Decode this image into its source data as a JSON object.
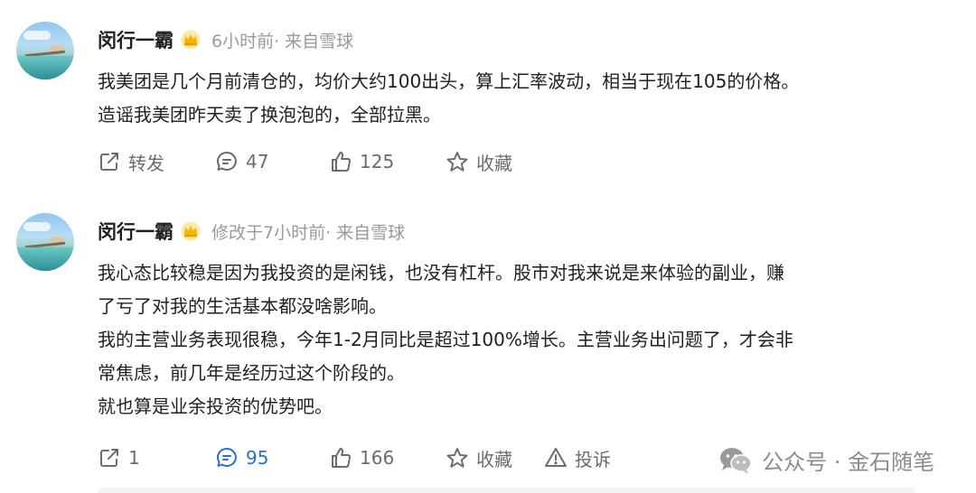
{
  "posts": [
    {
      "author": "闵行一霸",
      "meta": "6小时前· 来自雪球",
      "lines": [
        "我美团是几个月前清仓的，均价大约100出头，算上汇率波动，相当于现在105的价格。",
        "造谣我美团昨天卖了换泡泡的，全部拉黑。"
      ],
      "actions": {
        "repost": "转发",
        "comment": "47",
        "like": "125",
        "favorite": "收藏"
      }
    },
    {
      "author": "闵行一霸",
      "meta": "修改于7小时前· 来自雪球",
      "lines": [
        "我心态比较稳是因为我投资的是闲钱，也没有杠杆。股市对我来说是来体验的副业，赚",
        "了亏了对我的生活基本都没啥影响。",
        "我的主营业务表现很稳，今年1-2月同比是超过100%增长。主营业务出问题了，才会非",
        "常焦虑，前几年是经历过这个阶段的。",
        "就也算是业余投资的优势吧。"
      ],
      "actions": {
        "repost": "1",
        "comment": "95",
        "like": "166",
        "favorite": "收藏",
        "report": "投诉"
      }
    }
  ],
  "watermark": "公众号 · 金石随笔",
  "icons": {
    "badge": "gold-crown-badge-icon",
    "repost": "share-box-icon",
    "comment": "chat-bubble-icon",
    "like": "thumbs-up-icon",
    "favorite": "star-icon",
    "report": "warning-icon",
    "watermark": "wechat-icon"
  },
  "colors": {
    "text": "#1f1f1f",
    "meta": "#9a9a9a",
    "action": "#6b6b6b",
    "active": "#2a6fd8",
    "badge": "#f5b400"
  }
}
